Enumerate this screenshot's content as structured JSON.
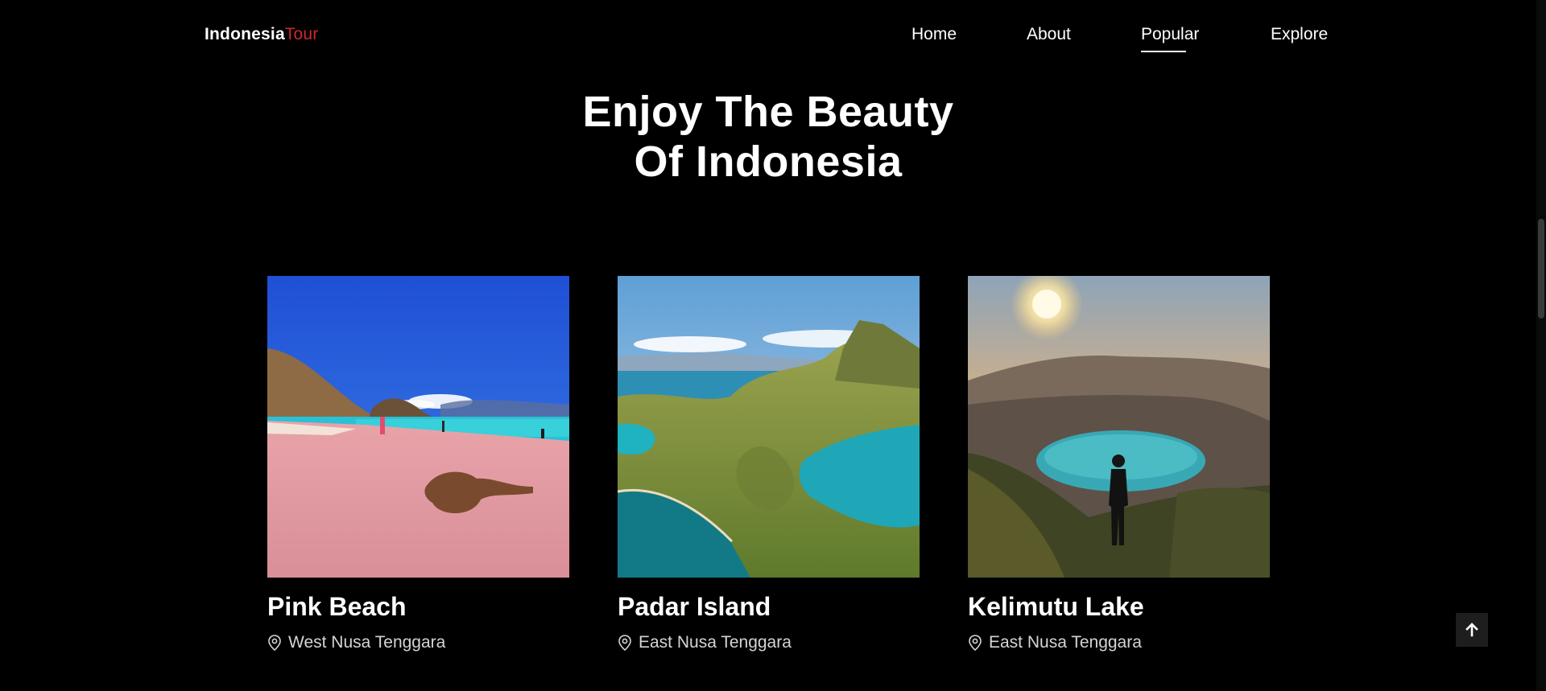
{
  "brand": {
    "name": "Indonesia",
    "accent": "Tour",
    "accent_color": "#d0282a"
  },
  "nav": {
    "items": [
      {
        "label": "Home",
        "active": false
      },
      {
        "label": "About",
        "active": false
      },
      {
        "label": "Popular",
        "active": true
      },
      {
        "label": "Explore",
        "active": false
      }
    ]
  },
  "hero": {
    "title_line1": "Enjoy The Beauty",
    "title_line2": "Of Indonesia"
  },
  "cards": [
    {
      "name": "Pink Beach",
      "location": "West Nusa Tenggara",
      "icon": "location-pin-icon"
    },
    {
      "name": "Padar Island",
      "location": "East Nusa Tenggara",
      "icon": "location-pin-icon"
    },
    {
      "name": "Kelimutu Lake",
      "location": "East Nusa Tenggara",
      "icon": "location-pin-icon"
    }
  ],
  "scroll_top": {
    "icon": "arrow-up-icon"
  }
}
